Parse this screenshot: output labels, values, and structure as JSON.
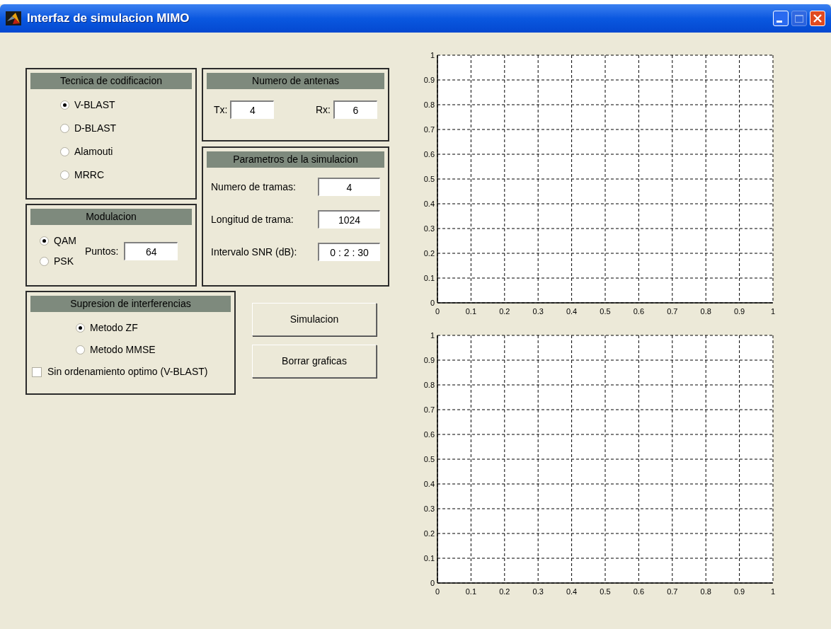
{
  "window": {
    "title": "Interfaz de simulacion MIMO"
  },
  "coding": {
    "title": "Tecnica de codificacion",
    "options": [
      {
        "label": "V-BLAST",
        "selected": true
      },
      {
        "label": "D-BLAST",
        "selected": false
      },
      {
        "label": "Alamouti",
        "selected": false
      },
      {
        "label": "MRRC",
        "selected": false
      }
    ]
  },
  "antennas": {
    "title": "Numero de antenas",
    "fields": [
      {
        "label": "Tx:",
        "value": "4"
      },
      {
        "label": "Rx:",
        "value": "6"
      }
    ]
  },
  "params": {
    "title": "Parametros de la simulacion",
    "fields": [
      {
        "label": "Numero de tramas:",
        "value": "4"
      },
      {
        "label": "Longitud de trama:",
        "value": "1024"
      },
      {
        "label": "Intervalo SNR (dB):",
        "value": "0 : 2 : 30"
      }
    ]
  },
  "modulation": {
    "title": "Modulacion",
    "options": [
      {
        "label": "QAM",
        "selected": true
      },
      {
        "label": "PSK",
        "selected": false
      }
    ],
    "points": {
      "label": "Puntos:",
      "value": "64"
    }
  },
  "interference": {
    "title": "Supresion de interferencias",
    "options": [
      {
        "label": "Metodo ZF",
        "selected": true
      },
      {
        "label": "Metodo MMSE",
        "selected": false
      }
    ],
    "checkbox": {
      "label": "Sin ordenamiento optimo (V-BLAST)",
      "checked": false
    }
  },
  "buttons": [
    "Simulacion",
    "Borrar graficas"
  ],
  "plots": [
    {
      "chart_data": {
        "type": "line",
        "grid": true,
        "xlim": [
          0,
          1
        ],
        "ylim": [
          0,
          1
        ],
        "xticks": [
          0,
          0.1,
          0.2,
          0.3,
          0.4,
          0.5,
          0.6,
          0.7,
          0.8,
          0.9,
          1
        ],
        "yticks": [
          0,
          0.1,
          0.2,
          0.3,
          0.4,
          0.5,
          0.6,
          0.7,
          0.8,
          0.9,
          1
        ]
      }
    },
    {
      "chart_data": {
        "type": "line",
        "grid": true,
        "xlim": [
          0,
          1
        ],
        "ylim": [
          0,
          1
        ],
        "xticks": [
          0,
          0.1,
          0.2,
          0.3,
          0.4,
          0.5,
          0.6,
          0.7,
          0.8,
          0.9,
          1
        ],
        "yticks": [
          0,
          0.1,
          0.2,
          0.3,
          0.4,
          0.5,
          0.6,
          0.7,
          0.8,
          0.9,
          1
        ]
      }
    }
  ]
}
